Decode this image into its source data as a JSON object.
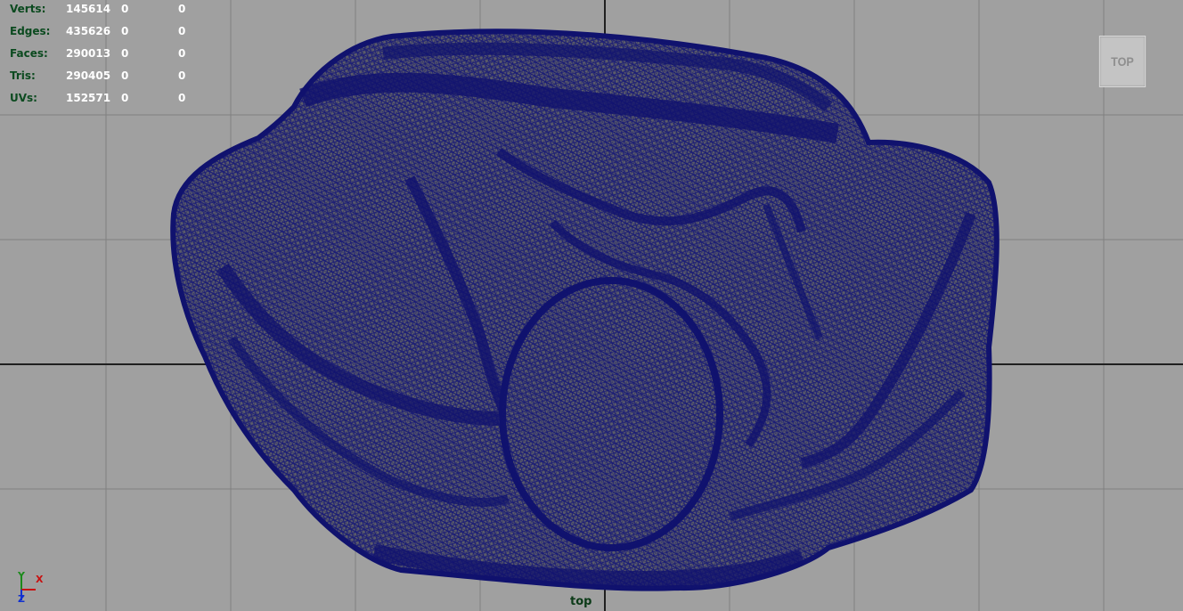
{
  "hud": {
    "rows": [
      {
        "label": "Verts:",
        "v1": "145614",
        "v2": "0",
        "v3": "0"
      },
      {
        "label": "Edges:",
        "v1": "435626",
        "v2": "0",
        "v3": "0"
      },
      {
        "label": "Faces:",
        "v1": "290013",
        "v2": "0",
        "v3": "0"
      },
      {
        "label": "Tris:",
        "v1": "290405",
        "v2": "0",
        "v3": "0"
      },
      {
        "label": "UVs:",
        "v1": "152571",
        "v2": "0",
        "v3": "0"
      }
    ]
  },
  "view_cube": {
    "label": "TOP"
  },
  "camera": {
    "name": "top"
  },
  "axis": {
    "y": "Y",
    "x": "X",
    "z": "Z"
  },
  "colors": {
    "background": "#a0a0a0",
    "grid": "#808080",
    "origin_axis": "#202020",
    "wireframe": "#151878",
    "surface": "#5f5f6a"
  },
  "mesh": {
    "icon": "wireframe-mesh"
  }
}
